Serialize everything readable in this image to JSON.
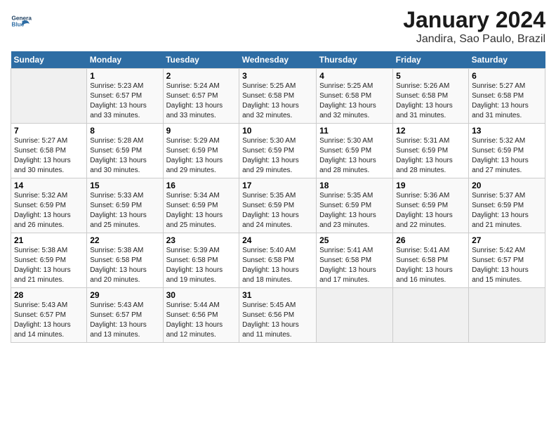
{
  "header": {
    "logo_line1": "General",
    "logo_line2": "Blue",
    "title": "January 2024",
    "subtitle": "Jandira, Sao Paulo, Brazil"
  },
  "days_of_week": [
    "Sunday",
    "Monday",
    "Tuesday",
    "Wednesday",
    "Thursday",
    "Friday",
    "Saturday"
  ],
  "weeks": [
    [
      {
        "day": "",
        "info": ""
      },
      {
        "day": "1",
        "info": "Sunrise: 5:23 AM\nSunset: 6:57 PM\nDaylight: 13 hours\nand 33 minutes."
      },
      {
        "day": "2",
        "info": "Sunrise: 5:24 AM\nSunset: 6:57 PM\nDaylight: 13 hours\nand 33 minutes."
      },
      {
        "day": "3",
        "info": "Sunrise: 5:25 AM\nSunset: 6:58 PM\nDaylight: 13 hours\nand 32 minutes."
      },
      {
        "day": "4",
        "info": "Sunrise: 5:25 AM\nSunset: 6:58 PM\nDaylight: 13 hours\nand 32 minutes."
      },
      {
        "day": "5",
        "info": "Sunrise: 5:26 AM\nSunset: 6:58 PM\nDaylight: 13 hours\nand 31 minutes."
      },
      {
        "day": "6",
        "info": "Sunrise: 5:27 AM\nSunset: 6:58 PM\nDaylight: 13 hours\nand 31 minutes."
      }
    ],
    [
      {
        "day": "7",
        "info": "Sunrise: 5:27 AM\nSunset: 6:58 PM\nDaylight: 13 hours\nand 30 minutes."
      },
      {
        "day": "8",
        "info": "Sunrise: 5:28 AM\nSunset: 6:59 PM\nDaylight: 13 hours\nand 30 minutes."
      },
      {
        "day": "9",
        "info": "Sunrise: 5:29 AM\nSunset: 6:59 PM\nDaylight: 13 hours\nand 29 minutes."
      },
      {
        "day": "10",
        "info": "Sunrise: 5:30 AM\nSunset: 6:59 PM\nDaylight: 13 hours\nand 29 minutes."
      },
      {
        "day": "11",
        "info": "Sunrise: 5:30 AM\nSunset: 6:59 PM\nDaylight: 13 hours\nand 28 minutes."
      },
      {
        "day": "12",
        "info": "Sunrise: 5:31 AM\nSunset: 6:59 PM\nDaylight: 13 hours\nand 28 minutes."
      },
      {
        "day": "13",
        "info": "Sunrise: 5:32 AM\nSunset: 6:59 PM\nDaylight: 13 hours\nand 27 minutes."
      }
    ],
    [
      {
        "day": "14",
        "info": "Sunrise: 5:32 AM\nSunset: 6:59 PM\nDaylight: 13 hours\nand 26 minutes."
      },
      {
        "day": "15",
        "info": "Sunrise: 5:33 AM\nSunset: 6:59 PM\nDaylight: 13 hours\nand 25 minutes."
      },
      {
        "day": "16",
        "info": "Sunrise: 5:34 AM\nSunset: 6:59 PM\nDaylight: 13 hours\nand 25 minutes."
      },
      {
        "day": "17",
        "info": "Sunrise: 5:35 AM\nSunset: 6:59 PM\nDaylight: 13 hours\nand 24 minutes."
      },
      {
        "day": "18",
        "info": "Sunrise: 5:35 AM\nSunset: 6:59 PM\nDaylight: 13 hours\nand 23 minutes."
      },
      {
        "day": "19",
        "info": "Sunrise: 5:36 AM\nSunset: 6:59 PM\nDaylight: 13 hours\nand 22 minutes."
      },
      {
        "day": "20",
        "info": "Sunrise: 5:37 AM\nSunset: 6:59 PM\nDaylight: 13 hours\nand 21 minutes."
      }
    ],
    [
      {
        "day": "21",
        "info": "Sunrise: 5:38 AM\nSunset: 6:59 PM\nDaylight: 13 hours\nand 21 minutes."
      },
      {
        "day": "22",
        "info": "Sunrise: 5:38 AM\nSunset: 6:58 PM\nDaylight: 13 hours\nand 20 minutes."
      },
      {
        "day": "23",
        "info": "Sunrise: 5:39 AM\nSunset: 6:58 PM\nDaylight: 13 hours\nand 19 minutes."
      },
      {
        "day": "24",
        "info": "Sunrise: 5:40 AM\nSunset: 6:58 PM\nDaylight: 13 hours\nand 18 minutes."
      },
      {
        "day": "25",
        "info": "Sunrise: 5:41 AM\nSunset: 6:58 PM\nDaylight: 13 hours\nand 17 minutes."
      },
      {
        "day": "26",
        "info": "Sunrise: 5:41 AM\nSunset: 6:58 PM\nDaylight: 13 hours\nand 16 minutes."
      },
      {
        "day": "27",
        "info": "Sunrise: 5:42 AM\nSunset: 6:57 PM\nDaylight: 13 hours\nand 15 minutes."
      }
    ],
    [
      {
        "day": "28",
        "info": "Sunrise: 5:43 AM\nSunset: 6:57 PM\nDaylight: 13 hours\nand 14 minutes."
      },
      {
        "day": "29",
        "info": "Sunrise: 5:43 AM\nSunset: 6:57 PM\nDaylight: 13 hours\nand 13 minutes."
      },
      {
        "day": "30",
        "info": "Sunrise: 5:44 AM\nSunset: 6:56 PM\nDaylight: 13 hours\nand 12 minutes."
      },
      {
        "day": "31",
        "info": "Sunrise: 5:45 AM\nSunset: 6:56 PM\nDaylight: 13 hours\nand 11 minutes."
      },
      {
        "day": "",
        "info": ""
      },
      {
        "day": "",
        "info": ""
      },
      {
        "day": "",
        "info": ""
      }
    ]
  ]
}
